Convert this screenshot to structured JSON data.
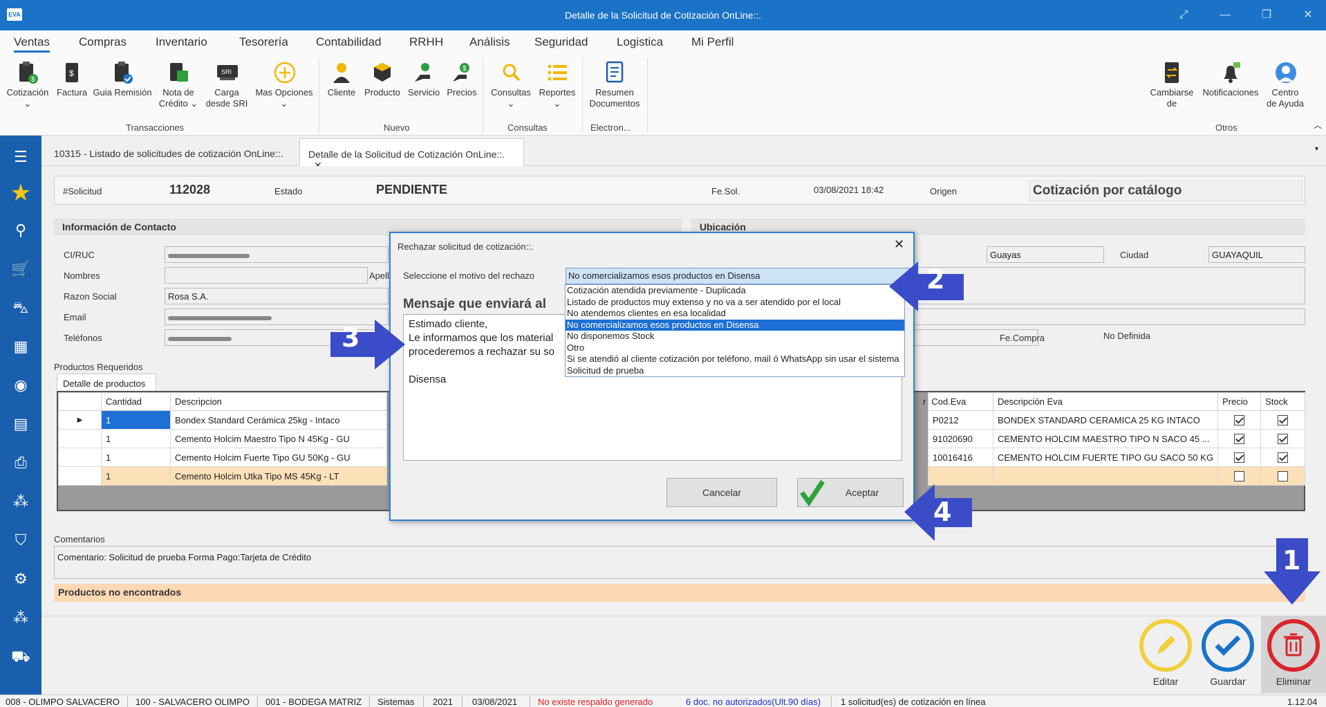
{
  "window": {
    "logo": "EVA",
    "title": "Detalle de la Solicitud de Cotización OnLine::."
  },
  "menu": [
    "Ventas",
    "Compras",
    "Inventario",
    "Tesorería",
    "Contabilidad",
    "RRHH",
    "Análisis",
    "Seguridad",
    "Logistica",
    "Mi Perfil"
  ],
  "ribbon": {
    "cotizacion": "Cotización",
    "factura": "Factura",
    "guia": "Guia Remisión",
    "nota1": "Nota de",
    "nota2": "Crédito",
    "carga1": "Carga",
    "carga2": "desde SRI",
    "mas": "Mas Opciones",
    "cliente": "Cliente",
    "producto": "Producto",
    "servicio": "Servicio",
    "precios": "Precios",
    "consultas": "Consultas",
    "reportes": "Reportes",
    "resumen1": "Resumen",
    "resumen2": "Documentos",
    "cambiarse1": "Cambiarse",
    "cambiarse2": "de",
    "notificaciones": "Notificaciones",
    "centro1": "Centro",
    "centro2": "de Ayuda",
    "sri_badge": "SRI",
    "groups": {
      "transacciones": "Transacciones",
      "nuevo": "Nuevo",
      "consultas": "Consultas",
      "electron": "Electron...",
      "otros": "Otros"
    }
  },
  "tabs": {
    "tab1": "10315 - Listado de solicitudes de cotización OnLine::.",
    "tab2": "Detalle de la Solicitud de Cotización OnLine::."
  },
  "header": {
    "solicitud_label": "#Solicitud",
    "solicitud": "112028",
    "estado_label": "Estado",
    "estado": "PENDIENTE",
    "fesol_label": "Fe.Sol.",
    "fesol": "03/08/2021 18:42",
    "origen_label": "Origen",
    "origen": "Cotización por catálogo"
  },
  "contacto": {
    "title": "Información de Contacto",
    "ci_label": "CI/RUC",
    "nombres_label": "Nombres",
    "apell_label": "Apell",
    "razon_label": "Razon Social",
    "razon": "Rosa S.A.",
    "email_label": "Email",
    "tel_label": "Teléfonos"
  },
  "ubicacion": {
    "title": "Ubicación",
    "provincia": "Guayas",
    "ciudad_label": "Ciudad",
    "ciudad": "GUAYAQUIL",
    "fecompra_label": "Fe.Compra",
    "fecompra": "No Definida"
  },
  "productos": {
    "section": "Productos Requeridos",
    "tab": "Detalle de productos",
    "headers": {
      "cantidad": "Cantidad",
      "descripcion": "Descripcion",
      "cod": "Cod.Eva",
      "desc_eva": "Descripción Eva",
      "precio": "Precio",
      "stock": "Stock",
      "r": "r"
    },
    "rows": [
      {
        "cantidad": "1",
        "descripcion": "Bondex Standard Cerámica 25kg - Intaco",
        "cod": "P0212",
        "desc_eva": "BONDEX STANDARD CERAMICA 25 KG INTACO"
      },
      {
        "cantidad": "1",
        "descripcion": "Cemento Holcim Maestro Tipo N 45Kg - GU",
        "cod": "91020690",
        "desc_eva": "CEMENTO HOLCIM MAESTRO TIPO N SACO 45 ..."
      },
      {
        "cantidad": "1",
        "descripcion": "Cemento Holcim Fuerte Tipo GU 50Kg - GU",
        "cod": "10016416",
        "desc_eva": "CEMENTO HOLCIM FUERTE TIPO GU SACO 50 KG"
      },
      {
        "cantidad": "1",
        "descripcion": "Cemento Holcim Utka Tipo MS 45Kg - LT",
        "cod": "",
        "desc_eva": ""
      }
    ]
  },
  "comentarios": {
    "label": "Comentarios",
    "text": "Comentario: Solicitud de prueba Forma Pago:Tarjeta de Crédito",
    "no_encontrados": "Productos no encontrados"
  },
  "actions": {
    "editar": "Editar",
    "guardar": "Guardar",
    "eliminar": "Eliminar"
  },
  "status": {
    "s1": "008 - OLIMPO SALVACERO",
    "s2": "100 - SALVACERO OLIMPO",
    "s3": "001 - BODEGA MATRIZ",
    "s4": "Sistemas",
    "s5": "2021",
    "s6": "03/08/2021",
    "s7": "No existe respaldo generado",
    "s8": "6 doc. no autorizados(Ult.90 días)",
    "s9": "1 solicitud(es) de cotización en línea",
    "version": "1.12.04"
  },
  "dialog": {
    "title": "Rechazar solicitud de cotización::.",
    "motivo_label": "Seleccione  el motivo del rechazo",
    "selected": "No comercializamos esos productos en Disensa",
    "options": [
      "Cotización atendida previamente - Duplicada",
      "Listado de productos muy extenso y no va a ser atendido por el local",
      "No atendemos clientes en esa localidad",
      "No comercializamos esos productos en Disensa",
      "No disponemos Stock",
      "Otro",
      "Si se atendió al cliente cotización por teléfono, mail ó WhatsApp sin usar el sistema",
      "Solicitud de prueba"
    ],
    "mensaje_title": "Mensaje que enviará al",
    "msg1": "Estimado cliente,",
    "msg2": "Le informamos que los material",
    "msg3": "procederemos a rechazar su so",
    "msg4": "Disensa",
    "cancel": "Cancelar",
    "accept": "Aceptar"
  },
  "callouts": {
    "c1": "1",
    "c2": "2",
    "c3": "3",
    "c4": "4"
  },
  "colors": {
    "titlebar": "#1a73c7",
    "sidebar": "#1a5fad",
    "callout": "#3b4cc8",
    "selection": "#1e6fd6",
    "delete": "#d9252b",
    "edit": "#f2cf3c",
    "save": "#1a73c7"
  }
}
